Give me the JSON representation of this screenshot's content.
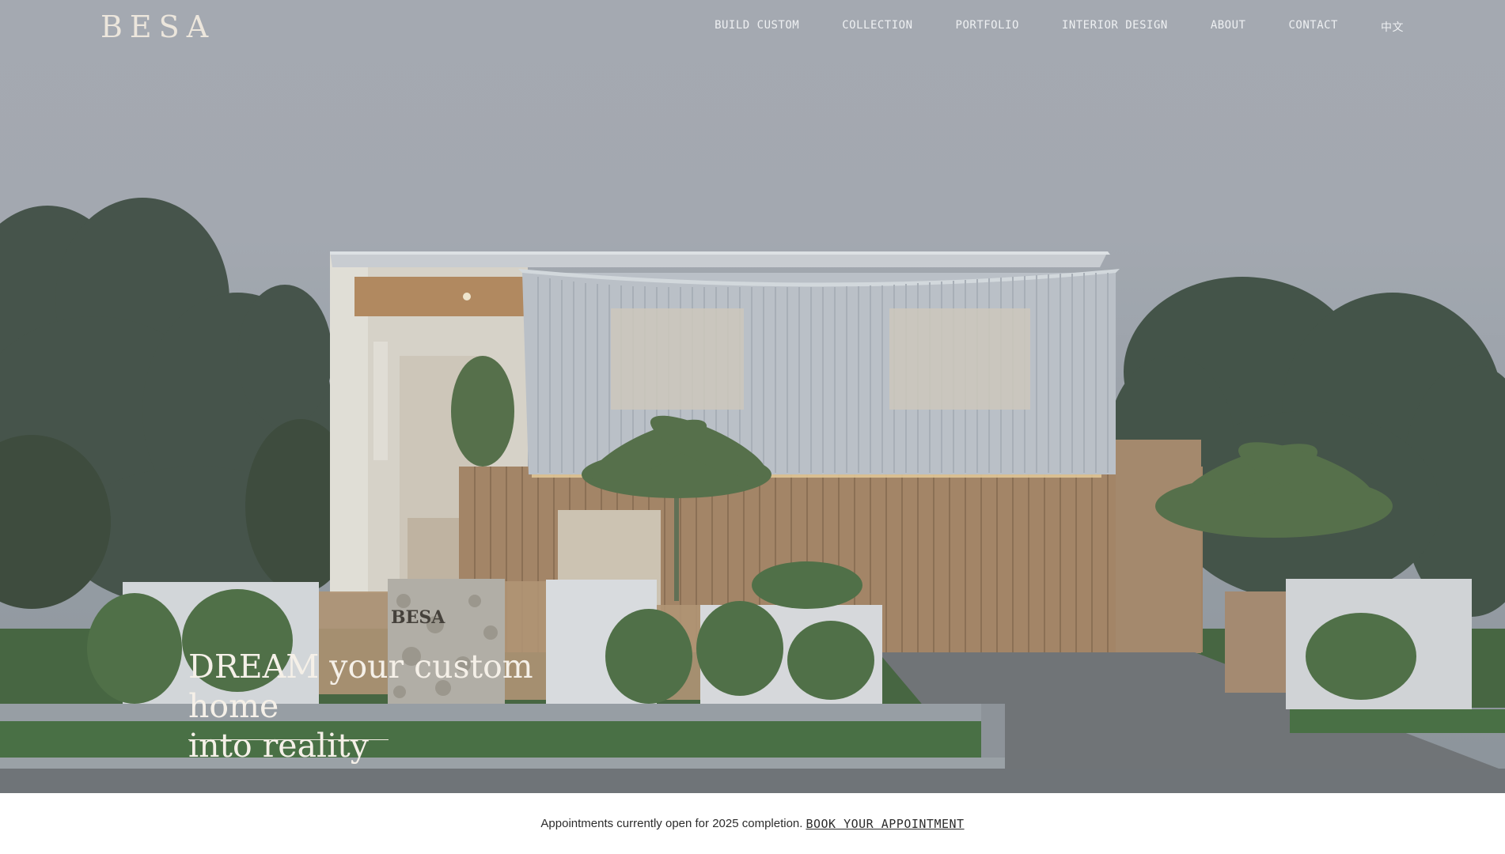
{
  "brand": {
    "logo": "BESA"
  },
  "nav": {
    "items": [
      "BUILD CUSTOM",
      "COLLECTION",
      "PORTFOLIO",
      "INTERIOR DESIGN",
      "ABOUT",
      "CONTACT",
      "中文"
    ]
  },
  "hero": {
    "headline_line1": "DREAM your custom home",
    "headline_line2": "into reality",
    "wall_sign": "BESA"
  },
  "banner": {
    "text": "Appointments currently open for 2025 completion.",
    "link": "BOOK YOUR APPOINTMENT"
  },
  "colors": {
    "sky": "#a9adb5",
    "timber": "#a8835f",
    "cladding": "#c3c8cf",
    "foliage": "#3b4a3b",
    "lawn": "#3f6a37"
  }
}
